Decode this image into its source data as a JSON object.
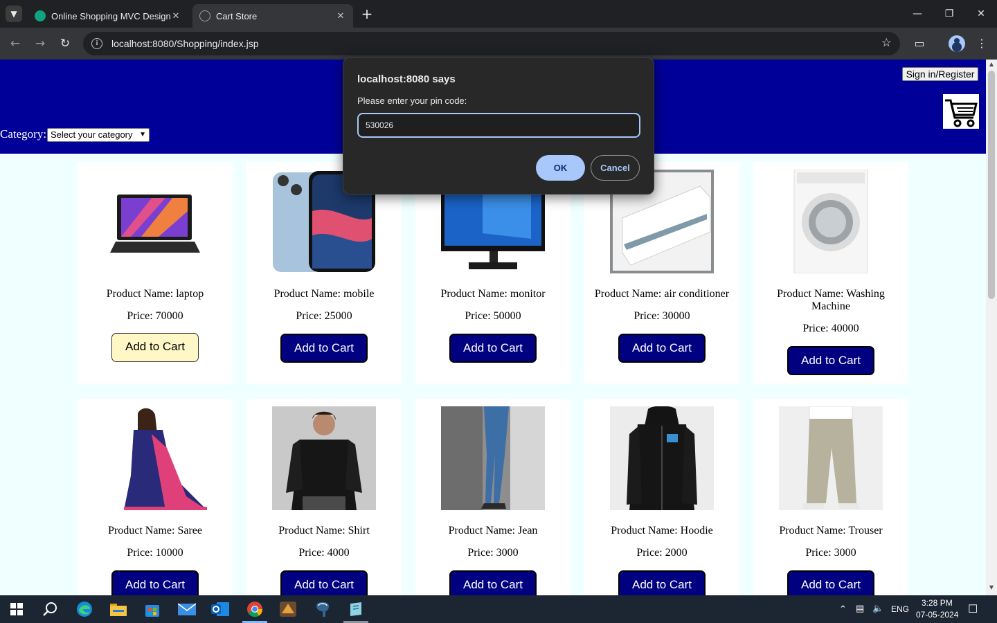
{
  "browser": {
    "tabs": [
      {
        "title": "Online Shopping MVC Design",
        "favicon_color": "#10a37f",
        "active": false
      },
      {
        "title": "Cart Store",
        "favicon_color": "#9aa0a6",
        "active": true
      }
    ],
    "url": "localhost:8080/Shopping/index.jsp"
  },
  "header": {
    "signin_label": "Sign in/Register",
    "category_label": "Category:",
    "category_selected": "Select your category",
    "background": "#000099"
  },
  "products": [
    {
      "name": "Product Name: laptop",
      "price": "Price: 70000",
      "button": "Add to Cart",
      "image": "laptop"
    },
    {
      "name": "Product Name: mobile",
      "price": "Price: 25000",
      "button": "Add to Cart",
      "image": "mobile"
    },
    {
      "name": "Product Name: monitor",
      "price": "Price: 50000",
      "button": "Add to Cart",
      "image": "monitor"
    },
    {
      "name": "Product Name: air conditioner",
      "price": "Price: 30000",
      "button": "Add to Cart",
      "image": "air-conditioner"
    },
    {
      "name": "Product Name: Washing Machine",
      "price": "Price: 40000",
      "button": "Add to Cart",
      "image": "washing-machine"
    },
    {
      "name": "Product Name: Saree",
      "price": "Price: 10000",
      "button": "Add to Cart",
      "image": "saree"
    },
    {
      "name": "Product Name: Shirt",
      "price": "Price: 4000",
      "button": "Add to Cart",
      "image": "shirt"
    },
    {
      "name": "Product Name: Jean",
      "price": "Price: 3000",
      "button": "Add to Cart",
      "image": "jean"
    },
    {
      "name": "Product Name: Hoodie",
      "price": "Price: 2000",
      "button": "Add to Cart",
      "image": "hoodie"
    },
    {
      "name": "Product Name: Trouser",
      "price": "Price: 3000",
      "button": "Add to Cart",
      "image": "trouser"
    }
  ],
  "dialog": {
    "title": "localhost:8080 says",
    "message": "Please enter your pin code:",
    "input_value": "530026",
    "ok_label": "OK",
    "cancel_label": "Cancel"
  },
  "taskbar": {
    "lang": "ENG",
    "time": "3:28 PM",
    "date": "07-05-2024"
  }
}
